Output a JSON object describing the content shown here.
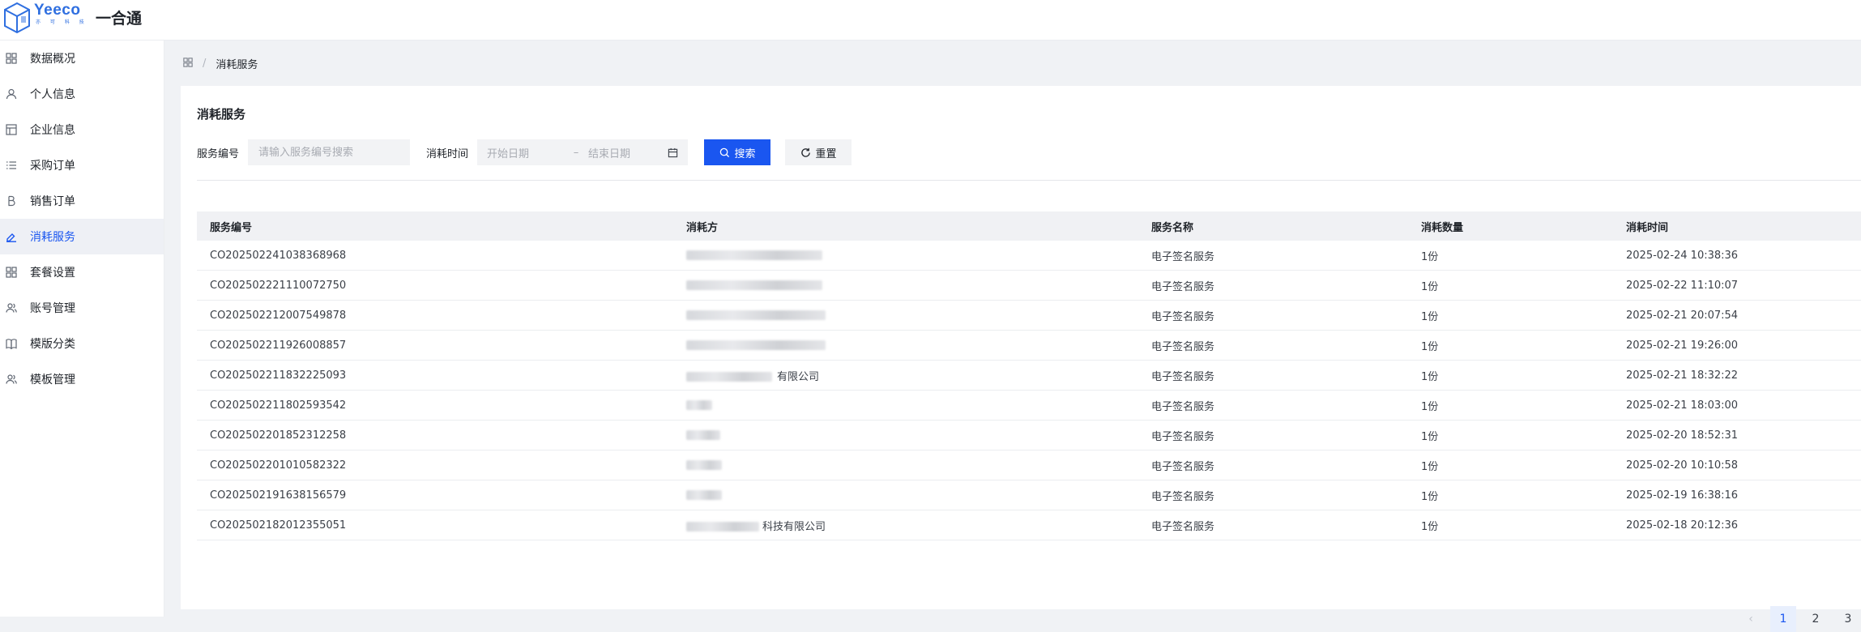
{
  "header": {
    "logo_brand": "Yeeco",
    "logo_sub": "亦 可 科 技",
    "app_name": "一合通"
  },
  "sidebar": {
    "items": [
      {
        "label": "数据概况",
        "icon": "grid-icon",
        "active": false
      },
      {
        "label": "个人信息",
        "icon": "user-icon",
        "active": false
      },
      {
        "label": "企业信息",
        "icon": "layout-icon",
        "active": false
      },
      {
        "label": "采购订单",
        "icon": "list-icon",
        "active": false
      },
      {
        "label": "销售订单",
        "icon": "b-letter-icon",
        "active": false
      },
      {
        "label": "消耗服务",
        "icon": "pen-icon",
        "active": true
      },
      {
        "label": "套餐设置",
        "icon": "grid-icon",
        "active": false
      },
      {
        "label": "账号管理",
        "icon": "users-icon",
        "active": false
      },
      {
        "label": "模版分类",
        "icon": "book-icon",
        "active": false
      },
      {
        "label": "模板管理",
        "icon": "users-icon",
        "active": false
      }
    ]
  },
  "breadcrumb": {
    "sep": "/",
    "current": "消耗服务"
  },
  "card": {
    "title": "消耗服务"
  },
  "filter": {
    "service_no_label": "服务编号",
    "service_no_placeholder": "请输入服务编号搜索",
    "time_label": "消耗时间",
    "start_placeholder": "开始日期",
    "dash": "–",
    "end_placeholder": "结束日期",
    "search_label": "搜索",
    "reset_label": "重置"
  },
  "table": {
    "headers": {
      "id": "服务编号",
      "party": "消耗方",
      "name": "服务名称",
      "qty": "消耗数量",
      "time": "消耗时间"
    },
    "rows": [
      {
        "id": "CO202502241038368968",
        "party_suffix": "",
        "name": "电子签名服务",
        "qty": "1份",
        "time": "2025-02-24 10:38:36"
      },
      {
        "id": "CO202502221110072750",
        "party_suffix": "",
        "name": "电子签名服务",
        "qty": "1份",
        "time": "2025-02-22 11:10:07"
      },
      {
        "id": "CO202502212007549878",
        "party_suffix": "",
        "name": "电子签名服务",
        "qty": "1份",
        "time": "2025-02-21 20:07:54"
      },
      {
        "id": "CO202502211926008857",
        "party_suffix": "",
        "name": "电子签名服务",
        "qty": "1份",
        "time": "2025-02-21 19:26:00"
      },
      {
        "id": "CO202502211832225093",
        "party_suffix": "有限公司",
        "name": "电子签名服务",
        "qty": "1份",
        "time": "2025-02-21 18:32:22"
      },
      {
        "id": "CO202502211802593542",
        "party_suffix": "",
        "name": "电子签名服务",
        "qty": "1份",
        "time": "2025-02-21 18:03:00"
      },
      {
        "id": "CO202502201852312258",
        "party_suffix": "",
        "name": "电子签名服务",
        "qty": "1份",
        "time": "2025-02-20 18:52:31"
      },
      {
        "id": "CO202502201010582322",
        "party_suffix": "",
        "name": "电子签名服务",
        "qty": "1份",
        "time": "2025-02-20 10:10:58"
      },
      {
        "id": "CO202502191638156579",
        "party_suffix": "",
        "name": "电子签名服务",
        "qty": "1份",
        "time": "2025-02-19 16:38:16"
      },
      {
        "id": "CO202502182012355051",
        "party_suffix": "科技有限公司",
        "name": "电子签名服务",
        "qty": "1份",
        "time": "2025-02-18 20:12:36"
      }
    ]
  },
  "pagination": {
    "prev": "‹",
    "pages": [
      "1",
      "2",
      "3"
    ],
    "current": "1"
  },
  "colors": {
    "accent": "#1a56f0",
    "active_bg": "#eef0f5"
  }
}
